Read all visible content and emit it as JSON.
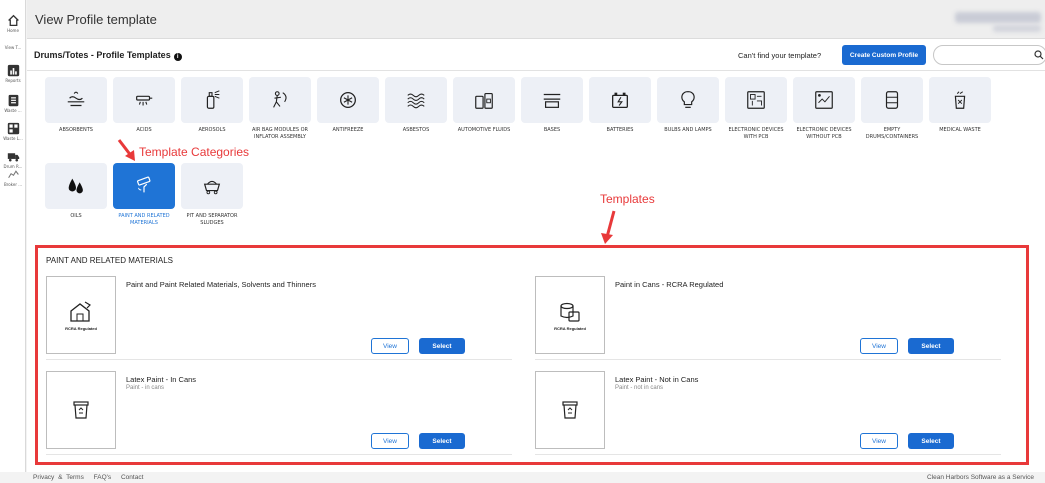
{
  "window": {
    "title": "View Profile template"
  },
  "rail": {
    "items": [
      {
        "label": "Home",
        "icon": "home-icon"
      },
      {
        "label": "View T...",
        "icon": "view-icon"
      },
      {
        "label": "Reports",
        "icon": "reports-icon"
      },
      {
        "label": "Waste ...",
        "icon": "waste-icon"
      },
      {
        "label": "Waste L...",
        "icon": "waste-list-icon"
      },
      {
        "label": "Drum R...",
        "icon": "truck-icon"
      },
      {
        "label": "Broker ...",
        "icon": "broker-icon"
      }
    ]
  },
  "header": {
    "title": "Drums/Totes - Profile Templates",
    "info_icon": "info-icon",
    "cant_find": "Can't find your template?",
    "custom_button": "Create Custom Profile",
    "search_placeholder": ""
  },
  "categories": {
    "row1": [
      {
        "label": "ABSORBENTS",
        "icon": "absorbent-icon"
      },
      {
        "label": "ACIDS",
        "icon": "acid-icon"
      },
      {
        "label": "AEROSOLS",
        "icon": "aerosol-icon"
      },
      {
        "label": "AIR BAG MODULES OR INFLATOR ASSEMBLY",
        "icon": "airbag-icon"
      },
      {
        "label": "ANTIFREEZE",
        "icon": "antifreeze-icon"
      },
      {
        "label": "ASBESTOS",
        "icon": "asbestos-icon"
      },
      {
        "label": "AUTOMOTIVE FLUIDS",
        "icon": "automotive-fluids-icon"
      },
      {
        "label": "BASES",
        "icon": "bases-icon"
      },
      {
        "label": "BATTERIES",
        "icon": "battery-icon"
      },
      {
        "label": "BULBS AND LAMPS",
        "icon": "bulb-icon"
      },
      {
        "label": "ELECTRONIC DEVICES WITH PCB",
        "icon": "electronic-pcb-icon"
      },
      {
        "label": "ELECTRONIC DEVICES WITHOUT PCB",
        "icon": "electronic-no-pcb-icon"
      },
      {
        "label": "EMPTY DRUMS/CONTAINERS",
        "icon": "drum-icon"
      },
      {
        "label": "MEDICAL WASTE",
        "icon": "medical-waste-icon"
      }
    ],
    "row2": [
      {
        "label": "OILS",
        "icon": "oil-drops-icon"
      },
      {
        "label": "PAINT AND RELATED MATERIALS",
        "icon": "paint-roller-icon",
        "selected": true
      },
      {
        "label": "PIT AND SEPARATOR SLUDGES",
        "icon": "sludge-cart-icon"
      }
    ]
  },
  "annotations": {
    "categories": "Template Categories",
    "templates": "Templates"
  },
  "templates": {
    "section_title": "PAINT AND RELATED MATERIALS",
    "view_label": "View",
    "select_label": "Select",
    "cards": [
      {
        "title": "Paint and Paint Related Materials, Solvents and Thinners",
        "subtitle": "",
        "thumb_caption": "RCRA Regulated",
        "icon": "paint-house-icon"
      },
      {
        "title": "Paint in Cans - RCRA Regulated",
        "subtitle": "",
        "thumb_caption": "RCRA Regulated",
        "icon": "paint-cans-icon"
      },
      {
        "title": "Latex Paint - In Cans",
        "subtitle": "Paint - in cans",
        "thumb_caption": "",
        "icon": "recycle-bin-icon"
      },
      {
        "title": "Latex Paint - Not in Cans",
        "subtitle": "Paint - not in cans",
        "thumb_caption": "",
        "icon": "recycle-bin-icon"
      }
    ]
  },
  "footer": {
    "links": [
      "Privacy & Terms",
      "FAQ's",
      "Contact"
    ],
    "right_text": "Clean Harbors Software as a Service"
  },
  "colors": {
    "accent": "#1a6ad1",
    "annotation": "#e8393a",
    "tile_bg": "#edf0f6"
  }
}
